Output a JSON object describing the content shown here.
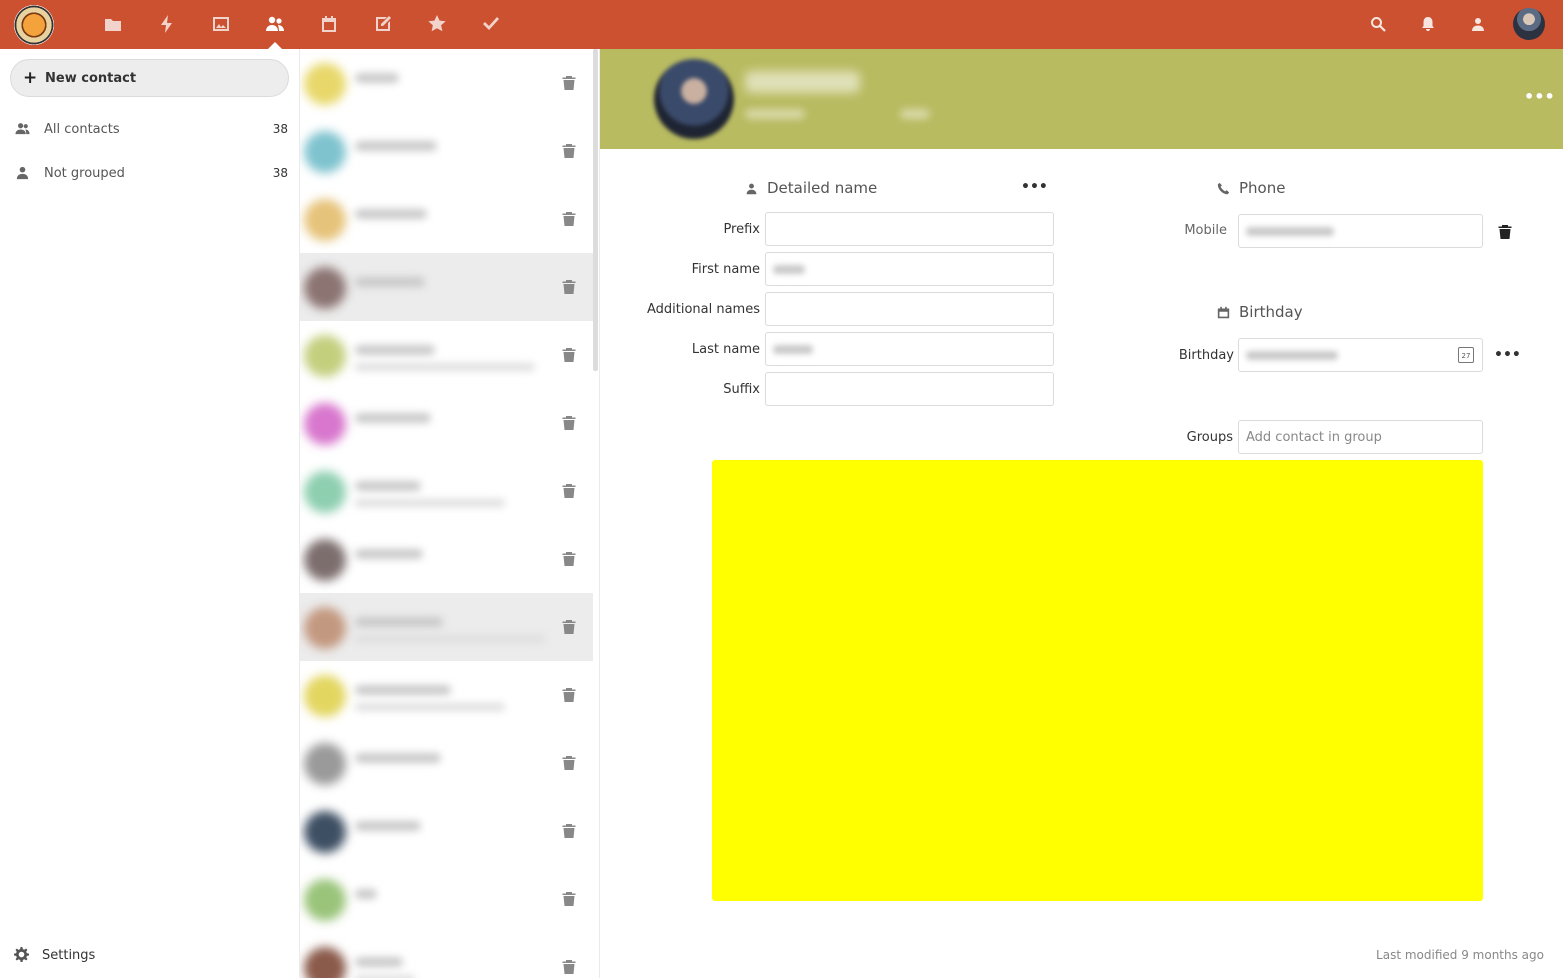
{
  "header": {
    "app_icons": [
      "files-icon",
      "activity-icon",
      "gallery-icon",
      "contacts-icon",
      "calendar-icon",
      "notes-icon",
      "favorites-icon",
      "tasks-icon"
    ],
    "active_app": "contacts-icon",
    "right_icons": [
      "search-icon",
      "notifications-icon",
      "contacts-menu-icon",
      "user-avatar"
    ],
    "brand_color": "#cb5130"
  },
  "nav": {
    "new_contact_label": "New contact",
    "items": [
      {
        "label": "All contacts",
        "count": "38",
        "icon": "contacts-group-icon"
      },
      {
        "label": "Not grouped",
        "count": "38",
        "icon": "person-icon"
      }
    ],
    "settings_label": "Settings"
  },
  "contact_list": {
    "rows": [
      {
        "avatar_color": "#e8d86a",
        "selected": false,
        "has_email": false
      },
      {
        "avatar_color": "#7fc3cf",
        "selected": false,
        "has_email": false
      },
      {
        "avatar_color": "#e6c37a",
        "selected": false,
        "has_email": false
      },
      {
        "avatar_color": "#8b7472",
        "selected": true,
        "has_email": false
      },
      {
        "avatar_color": "#c4cf7e",
        "selected": false,
        "has_email": true
      },
      {
        "avatar_color": "#d877cd",
        "selected": false,
        "has_email": false
      },
      {
        "avatar_color": "#8ecfb0",
        "selected": false,
        "has_email": true
      },
      {
        "avatar_color": "#7d6e6e",
        "selected": false,
        "has_email": false
      },
      {
        "avatar_color": "#c39880",
        "selected": true,
        "has_email": true
      },
      {
        "avatar_color": "#e3d660",
        "selected": false,
        "has_email": true
      },
      {
        "avatar_color": "#9a9a9a",
        "selected": false,
        "has_email": false
      },
      {
        "avatar_color": "#3d4f63",
        "selected": false,
        "has_email": false
      },
      {
        "avatar_color": "#9ac47a",
        "selected": false,
        "has_email": false
      },
      {
        "avatar_color": "#8a5a4a",
        "selected": false,
        "has_email": true
      }
    ]
  },
  "detail": {
    "header_color": "#b9bb61",
    "detailed_name": {
      "title": "Detailed name",
      "fields": [
        {
          "label": "Prefix",
          "value": ""
        },
        {
          "label": "First name",
          "value": ""
        },
        {
          "label": "Additional names",
          "value": ""
        },
        {
          "label": "Last name",
          "value": ""
        },
        {
          "label": "Suffix",
          "value": ""
        }
      ]
    },
    "phone": {
      "title": "Phone",
      "label": "Mobile"
    },
    "birthday": {
      "title": "Birthday",
      "label": "Birthday",
      "calendar_day": "27"
    },
    "groups": {
      "label": "Groups",
      "placeholder": "Add contact in group"
    },
    "placeholder_box_color": "#ffff00",
    "last_modified": "Last modified 9 months ago"
  }
}
